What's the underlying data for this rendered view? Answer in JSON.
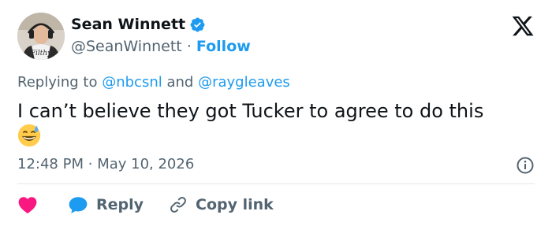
{
  "author": {
    "name": "Sean Winnett",
    "handle": "@SeanWinnett",
    "separator": "·",
    "follow_label": "Follow",
    "verified_color": "#1d9bf0"
  },
  "reply_context": {
    "prefix": "Replying to",
    "mentions": [
      "@nbcsnl",
      "@raygleaves"
    ],
    "joiner": "and"
  },
  "tweet": {
    "text": "I can’t believe they got Tucker to agree to do this",
    "emoji": "grinning-face-with-sweat"
  },
  "meta": {
    "time": "12:48 PM",
    "separator": "·",
    "date": "May 10, 2026"
  },
  "actions": {
    "like_icon": "heart-icon",
    "reply_label": "Reply",
    "copy_link_label": "Copy link"
  },
  "colors": {
    "accent": "#1d9bf0",
    "like": "#f91880",
    "secondary_text": "#536471",
    "primary_text": "#0f1419"
  }
}
